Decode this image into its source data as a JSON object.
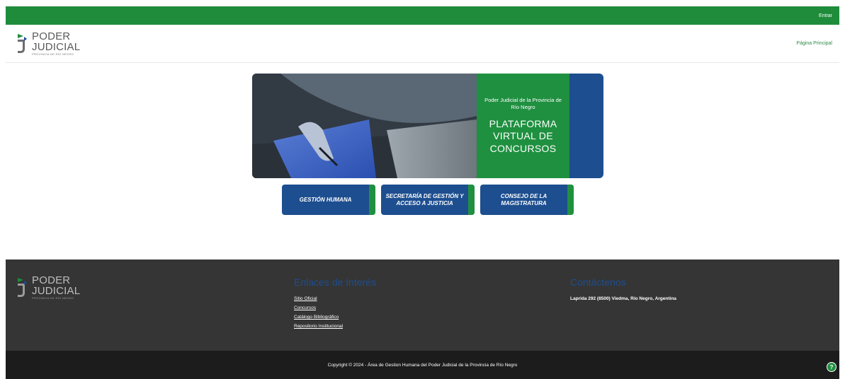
{
  "topbar": {
    "login_label": "Entrar"
  },
  "logo": {
    "line1": "PODER",
    "line2": "JUDICIAL",
    "line3": "PROVINCIA DE RÍO NEGRO"
  },
  "header": {
    "nav_home": "Página Principal"
  },
  "banner": {
    "subtitle": "Poder Judicial de la Provincia de Río Negro",
    "title_line1": "PLATAFORMA",
    "title_line2": "VIRTUAL DE",
    "title_line3": "CONCURSOS"
  },
  "buttons": [
    {
      "label": "GESTIÓN HUMANA"
    },
    {
      "label": "SECRETARÍA DE GESTIÓN Y ACCESO A JUSTICIA"
    },
    {
      "label": "CONSEJO DE LA MAGISTRATURA"
    }
  ],
  "footer": {
    "links_title": "Enlaces de Interés",
    "links": [
      "Sitio Oficial",
      "Concursos",
      "Catálogo Bibliográfico",
      "Repositorio Institucional"
    ],
    "contact_title": "Contáctenos",
    "address": "Laprida 292 (8500) Viedma, Río Negro, Argentina",
    "copyright": "Copyright © 2024 - Área de Gestion Humana del Poder Judicial de la Provincia de Río Negro",
    "help_label": "?"
  },
  "colors": {
    "green": "#1f8c3b",
    "blue": "#1d4e8f",
    "footer_bg": "#353535",
    "copyright_bg": "#1c1c1c"
  }
}
